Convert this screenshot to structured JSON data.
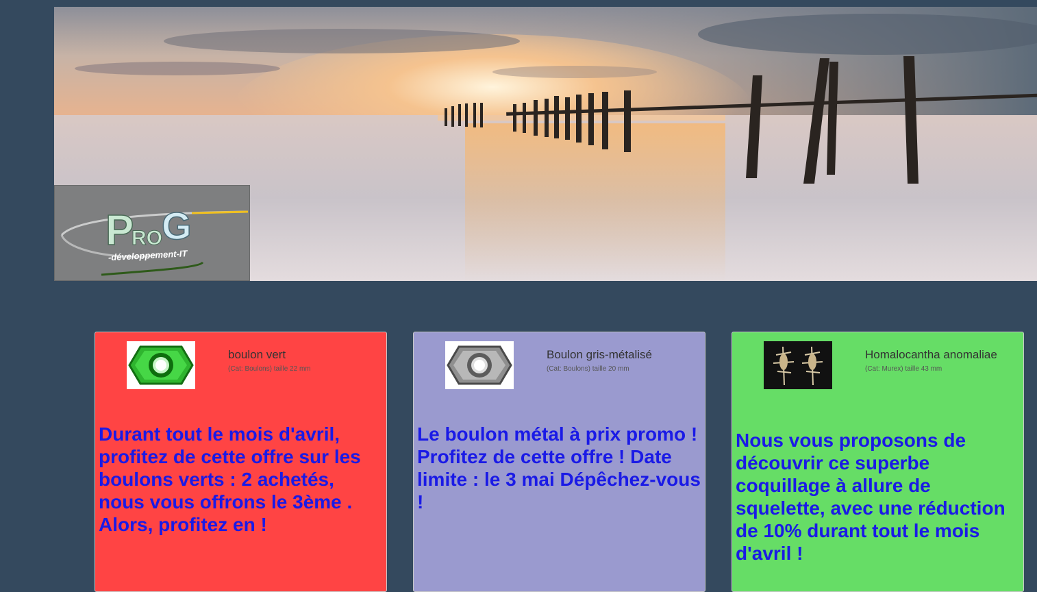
{
  "header": {
    "banner_icon": "sunset-pier-photo",
    "logo": {
      "text_p": "P",
      "text_ro": "RO",
      "text_g": "G",
      "tagline": "-développement-IT"
    }
  },
  "products": [
    {
      "name": "boulon vert",
      "category": "(Cat: Boulons) taille 22 mm",
      "promo": "Durant tout le mois d'avril, profitez de cette offre sur les boulons verts : 2 achetés, nous vous offrons le 3ème . Alors, profitez en !",
      "icon": "green-nut-photo",
      "card_color": "#ff4444"
    },
    {
      "name": "Boulon gris-métalisé",
      "category": "(Cat: Boulons) taille 20 mm",
      "promo": "Le boulon métal à prix promo ! Profitez de cette offre ! Date limite : le 3 mai Dépêchez-vous !",
      "icon": "metal-nut-photo",
      "card_color": "#9a9acf"
    },
    {
      "name": "Homalocantha anomaliae",
      "category": "(Cat: Murex) taille 43 mm",
      "promo": "Nous vous proposons de découvrir ce superbe coquillage à allure de squelette, avec une réduction de 10% durant tout le mois d'avril !",
      "icon": "shell-photo",
      "card_color": "#66dd66"
    }
  ]
}
